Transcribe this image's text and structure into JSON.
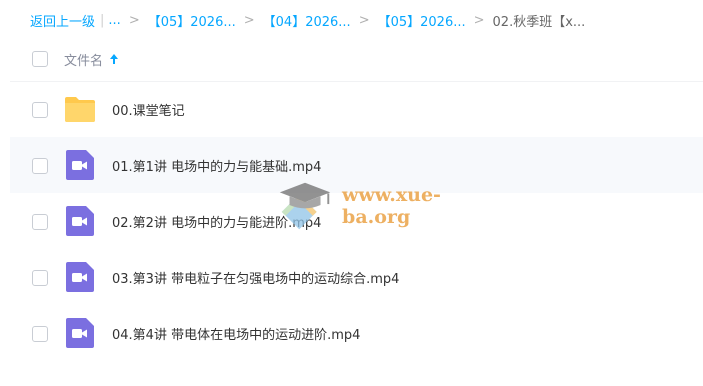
{
  "breadcrumb": {
    "back": "返回上一级",
    "ellipsis": "...",
    "crumbs": [
      "【05】2026...",
      "【04】2026...",
      "【05】2026..."
    ],
    "current": "02.秋季班【x..."
  },
  "table": {
    "header": "文件名"
  },
  "files": [
    {
      "name": "00.课堂笔记",
      "type": "folder"
    },
    {
      "name": "01.第1讲 电场中的力与能基础.mp4",
      "type": "video"
    },
    {
      "name": "02.第2讲 电场中的力与能进阶.mp4",
      "type": "video"
    },
    {
      "name": "03.第3讲 带电粒子在匀强电场中的运动综合.mp4",
      "type": "video"
    },
    {
      "name": "04.第4讲 带电体在电场中的运动进阶.mp4",
      "type": "video"
    }
  ],
  "watermark": "www.xue-ba.org",
  "colors": {
    "link": "#06a7ff",
    "folder": "#ffd66b",
    "video": "#7b6fe0",
    "watermark": "#e8962e"
  }
}
